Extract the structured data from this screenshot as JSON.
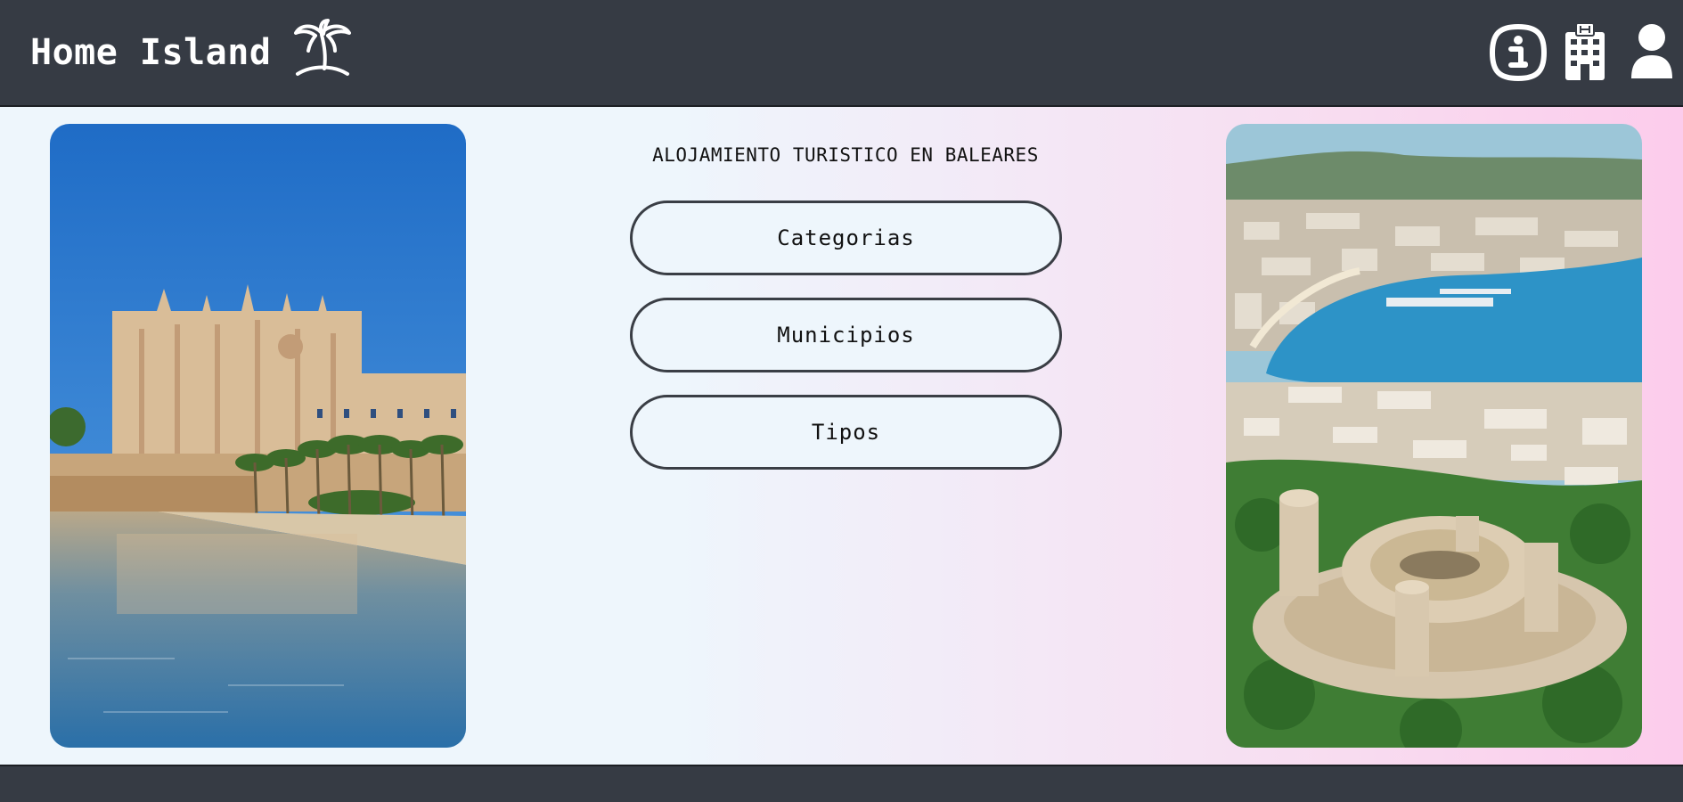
{
  "header": {
    "title": "Home Island",
    "logo_icon": "palm-tree-icon",
    "nav": [
      {
        "name": "info-icon"
      },
      {
        "name": "hotel-building-icon"
      },
      {
        "name": "user-icon"
      }
    ]
  },
  "main": {
    "subtitle": "ALOJAMIENTO TURISTICO EN BALEARES",
    "buttons": {
      "categorias": "Categorias",
      "municipios": "Municipios",
      "tipos": "Tipos"
    },
    "photos": {
      "left": "palma-cathedral-photo",
      "right": "bellver-castle-photo"
    }
  },
  "colors": {
    "header_bg": "#363b44",
    "page_bg": "#eef5fc",
    "accent_pink": "#fcccec",
    "button_border": "#3a3e45"
  }
}
